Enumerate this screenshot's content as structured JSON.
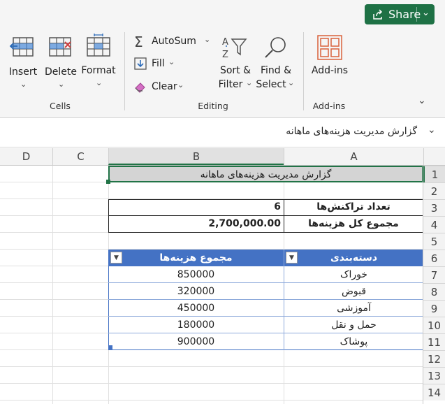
{
  "share": {
    "label": "Share",
    "icon": "share-icon"
  },
  "ribbon": {
    "cells": {
      "insert": "Insert",
      "delete": "Delete",
      "format": "Format",
      "group": "Cells"
    },
    "editing": {
      "autosum": "AutoSum",
      "fill": "Fill",
      "clear": "Clear",
      "sort_line1": "Sort &",
      "sort_line2": "Filter",
      "find_line1": "Find &",
      "find_line2": "Select",
      "group": "Editing"
    },
    "addins": {
      "label": "Add-ins",
      "group": "Add-ins"
    }
  },
  "formula_bar": {
    "value": "گزارش مدیریت هزینه‌های ماهانه"
  },
  "columns": [
    "A",
    "B",
    "C",
    "D"
  ],
  "rows": [
    "1",
    "2",
    "3",
    "4",
    "5",
    "6",
    "7",
    "8",
    "9",
    "10",
    "11",
    "12",
    "13",
    "14"
  ],
  "sheet": {
    "title": "گزارش مدیریت هزینه‌های ماهانه",
    "summary": [
      {
        "label": "تعداد تراکنش‌ها",
        "value": "6"
      },
      {
        "label": "مجموع کل هزینه‌ها",
        "value": "2,700,000.00"
      }
    ],
    "table": {
      "header_category": "دسته‌بندی",
      "header_total": "مجموع هزینه‌ها",
      "rows": [
        {
          "category": "خوراک",
          "total": "850000"
        },
        {
          "category": "قبوض",
          "total": "320000"
        },
        {
          "category": "آموزشی",
          "total": "450000"
        },
        {
          "category": "حمل و نقل",
          "total": "180000"
        },
        {
          "category": "پوشاک",
          "total": "900000"
        }
      ]
    }
  },
  "colors": {
    "accent": "#1e7145",
    "table_header": "#4472c4",
    "selection": "#217346"
  }
}
